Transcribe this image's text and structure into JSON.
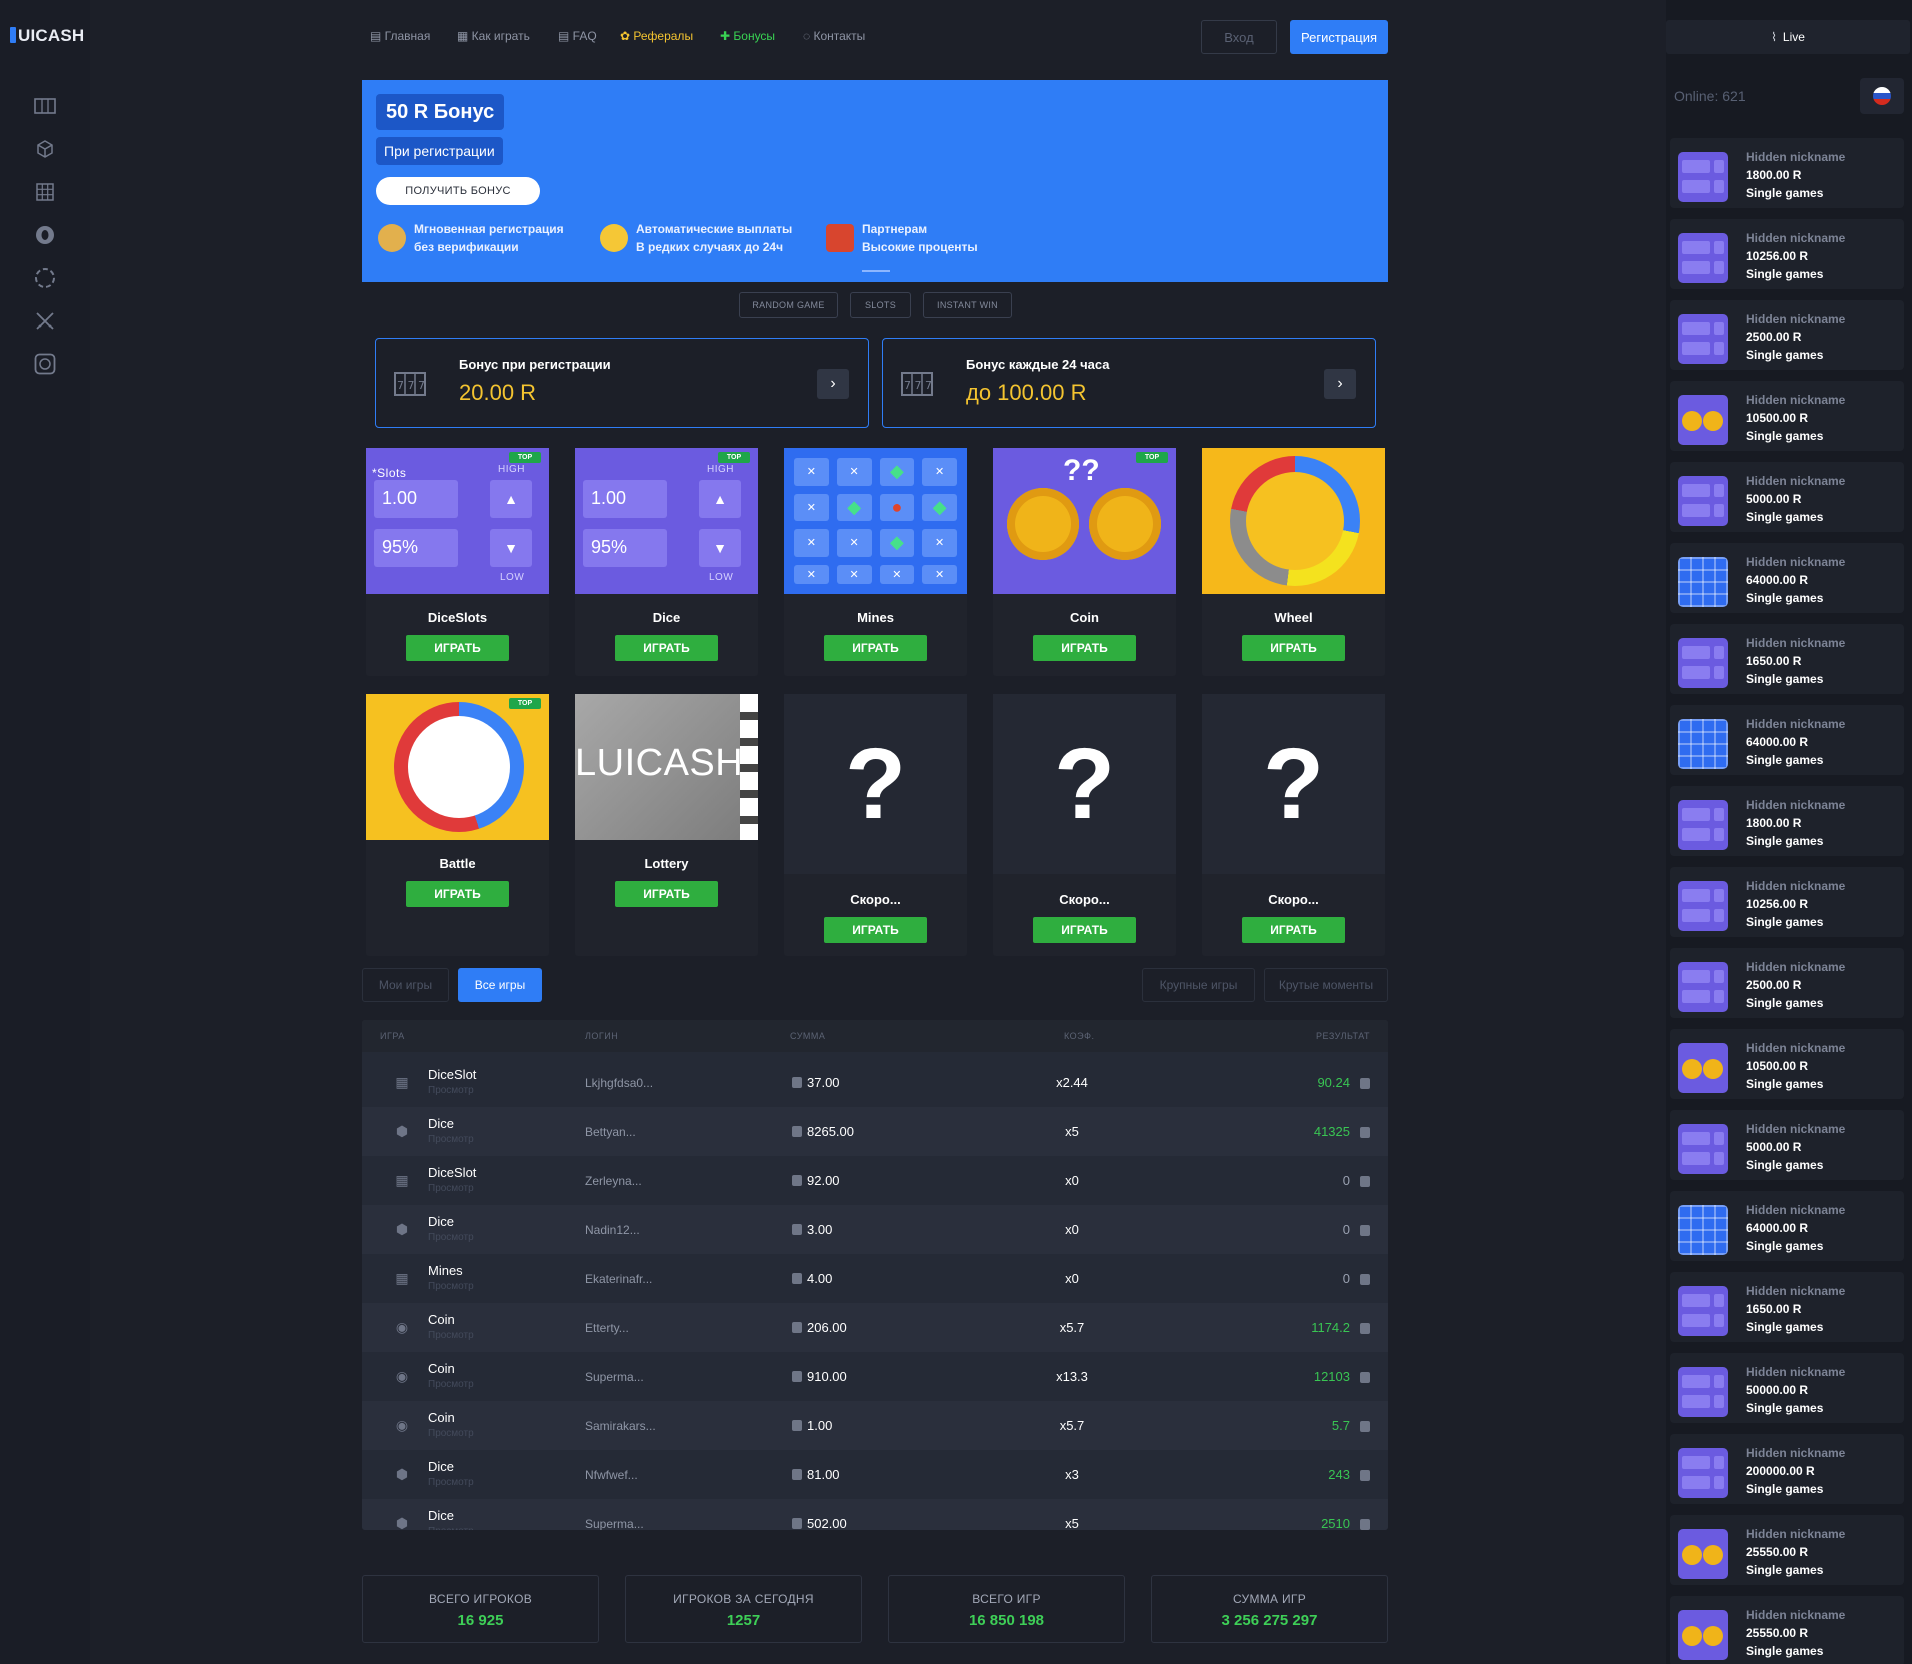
{
  "brand": {
    "logo": "UICASH"
  },
  "nav": [
    {
      "label": "Главная",
      "icon": "slots-icon",
      "color": "#8e94a4"
    },
    {
      "label": "Как играть",
      "icon": "book-icon",
      "color": "#8e94a4"
    },
    {
      "label": "FAQ",
      "icon": "faq-icon",
      "color": "#8e94a4"
    },
    {
      "label": "Рефералы",
      "icon": "referral-icon",
      "color": "#f4c430"
    },
    {
      "label": "Бонусы",
      "icon": "gift-icon",
      "color": "#39d353"
    },
    {
      "label": "Контакты",
      "icon": "headset-icon",
      "color": "#8e94a4"
    }
  ],
  "auth": {
    "login": "Вход",
    "register": "Регистрация"
  },
  "sidebar_icons": [
    "slots-icon",
    "cube-icon",
    "grid-icon",
    "coin-icon",
    "wheel-icon",
    "swords-icon",
    "lottery-icon"
  ],
  "banner": {
    "badge": "50 R Бонус",
    "subbadge": "При регистрации",
    "cta": "ПОЛУЧИТЬ БОНУС",
    "features": [
      {
        "line1": "Мгновенная регистрация",
        "line2": "без верификации",
        "icon": "worker-icon"
      },
      {
        "line1": "Автоматические выплаты",
        "line2": "В редких случаях до 24ч",
        "icon": "money-face-icon"
      },
      {
        "line1": "Партнерам",
        "line2": "Высокие проценты",
        "icon": "gift-icon"
      }
    ]
  },
  "tags": [
    "RANDOM GAME",
    "SLOTS",
    "INSTANT WIN"
  ],
  "bonus_cards": [
    {
      "title": "Бонус при регистрации",
      "value": "20.00 R"
    },
    {
      "title": "Бонус каждые 24 часа",
      "value": "до 100.00 R"
    }
  ],
  "play_label": "ИГРАТЬ",
  "top_label": "TOP",
  "games": [
    {
      "name": "DiceSlots",
      "top": true,
      "slots_label": "*Slots",
      "value": "1.00",
      "chance": "95%",
      "high": "HIGH",
      "low": "LOW"
    },
    {
      "name": "Dice",
      "top": true,
      "value": "1.00",
      "chance": "95%",
      "high": "HIGH",
      "low": "LOW"
    },
    {
      "name": "Mines",
      "top": false
    },
    {
      "name": "Coin",
      "top": true,
      "question": "??"
    },
    {
      "name": "Wheel",
      "top": false
    },
    {
      "name": "Battle",
      "top": true
    },
    {
      "name": "Lottery",
      "top": false,
      "thumb_text": "LUICASH"
    },
    {
      "name": "Скоро...",
      "top": false
    },
    {
      "name": "Скоро...",
      "top": false
    },
    {
      "name": "Скоро...",
      "top": false
    }
  ],
  "tabs": {
    "my": "Мои игры",
    "all": "Все игры",
    "big": "Крупные игры",
    "cool": "Крутые моменты"
  },
  "table": {
    "headers": {
      "game": "ИГРА",
      "login": "ЛОГИН",
      "sum": "СУММА",
      "coef": "КОЭФ.",
      "result": "РЕЗУЛЬТАТ"
    },
    "view_label": "Просмотр",
    "rows": [
      {
        "game": "DiceSlot",
        "icon": "slots-icon",
        "login": "Lkjhgfdsa0...",
        "sum": "37.00",
        "coef": "x2.44",
        "result": "90.24",
        "win": true
      },
      {
        "game": "Dice",
        "icon": "dice-icon",
        "login": "Bettyan...",
        "sum": "8265.00",
        "coef": "x5",
        "result": "41325",
        "win": true
      },
      {
        "game": "DiceSlot",
        "icon": "slots-icon",
        "login": "Zerleyna...",
        "sum": "92.00",
        "coef": "x0",
        "result": "0",
        "win": false
      },
      {
        "game": "Dice",
        "icon": "dice-icon",
        "login": "Nadin12...",
        "sum": "3.00",
        "coef": "x0",
        "result": "0",
        "win": false
      },
      {
        "game": "Mines",
        "icon": "grid-icon",
        "login": "Ekaterinafr...",
        "sum": "4.00",
        "coef": "x0",
        "result": "0",
        "win": false
      },
      {
        "game": "Coin",
        "icon": "coin-icon",
        "login": "Etterty...",
        "sum": "206.00",
        "coef": "x5.7",
        "result": "1174.2",
        "win": true
      },
      {
        "game": "Coin",
        "icon": "coin-icon",
        "login": "Superma...",
        "sum": "910.00",
        "coef": "x13.3",
        "result": "12103",
        "win": true
      },
      {
        "game": "Coin",
        "icon": "coin-icon",
        "login": "Samirakars...",
        "sum": "1.00",
        "coef": "x5.7",
        "result": "5.7",
        "win": true
      },
      {
        "game": "Dice",
        "icon": "dice-icon",
        "login": "Nfwfwef...",
        "sum": "81.00",
        "coef": "x3",
        "result": "243",
        "win": true
      },
      {
        "game": "Dice",
        "icon": "dice-icon",
        "login": "Superma...",
        "sum": "502.00",
        "coef": "x5",
        "result": "2510",
        "win": true
      }
    ]
  },
  "stats": [
    {
      "label": "ВСЕГО ИГРОКОВ",
      "value": "16 925"
    },
    {
      "label": "ИГРОКОВ ЗА СЕГОДНЯ",
      "value": "1257"
    },
    {
      "label": "ВСЕГО ИГР",
      "value": "16 850 198"
    },
    {
      "label": "СУММА ИГР",
      "value": "3 256 275 297"
    }
  ],
  "right_panel": {
    "live": "Live",
    "online": "Online: 621",
    "feed": [
      {
        "name": "Hidden nickname",
        "amount": "1800.00 R",
        "type": "Single games",
        "thumb": "dice"
      },
      {
        "name": "Hidden nickname",
        "amount": "10256.00 R",
        "type": "Single games",
        "thumb": "dice"
      },
      {
        "name": "Hidden nickname",
        "amount": "2500.00 R",
        "type": "Single games",
        "thumb": "dice"
      },
      {
        "name": "Hidden nickname",
        "amount": "10500.00 R",
        "type": "Single games",
        "thumb": "coin"
      },
      {
        "name": "Hidden nickname",
        "amount": "5000.00 R",
        "type": "Single games",
        "thumb": "dice"
      },
      {
        "name": "Hidden nickname",
        "amount": "64000.00 R",
        "type": "Single games",
        "thumb": "mines"
      },
      {
        "name": "Hidden nickname",
        "amount": "1650.00 R",
        "type": "Single games",
        "thumb": "dice"
      },
      {
        "name": "Hidden nickname",
        "amount": "64000.00 R",
        "type": "Single games",
        "thumb": "mines"
      },
      {
        "name": "Hidden nickname",
        "amount": "1800.00 R",
        "type": "Single games",
        "thumb": "dice"
      },
      {
        "name": "Hidden nickname",
        "amount": "10256.00 R",
        "type": "Single games",
        "thumb": "dice"
      },
      {
        "name": "Hidden nickname",
        "amount": "2500.00 R",
        "type": "Single games",
        "thumb": "dice"
      },
      {
        "name": "Hidden nickname",
        "amount": "10500.00 R",
        "type": "Single games",
        "thumb": "coin"
      },
      {
        "name": "Hidden nickname",
        "amount": "5000.00 R",
        "type": "Single games",
        "thumb": "dice"
      },
      {
        "name": "Hidden nickname",
        "amount": "64000.00 R",
        "type": "Single games",
        "thumb": "mines"
      },
      {
        "name": "Hidden nickname",
        "amount": "1650.00 R",
        "type": "Single games",
        "thumb": "dice"
      },
      {
        "name": "Hidden nickname",
        "amount": "50000.00 R",
        "type": "Single games",
        "thumb": "dice"
      },
      {
        "name": "Hidden nickname",
        "amount": "200000.00 R",
        "type": "Single games",
        "thumb": "dice"
      },
      {
        "name": "Hidden nickname",
        "amount": "25550.00 R",
        "type": "Single games",
        "thumb": "coin"
      },
      {
        "name": "Hidden nickname",
        "amount": "25550.00 R",
        "type": "Single games",
        "thumb": "coin"
      }
    ]
  },
  "colors": {
    "accent": "#2f7df6",
    "play": "#2fae3f",
    "gold": "#f4c430",
    "win": "#39c553"
  }
}
